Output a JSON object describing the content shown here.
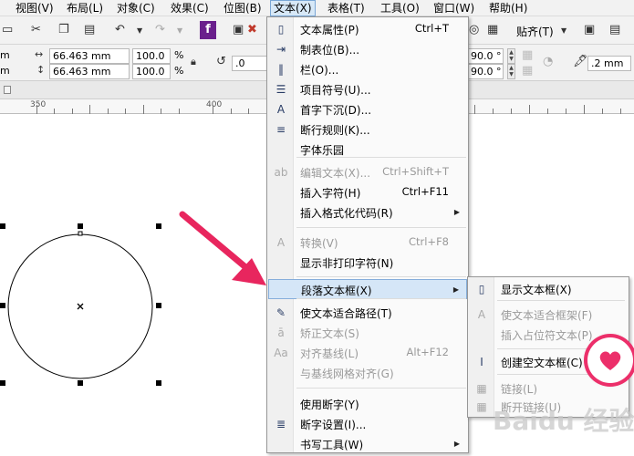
{
  "menubar": {
    "items": [
      {
        "label": "视图(V)"
      },
      {
        "label": "布局(L)"
      },
      {
        "label": "对象(C)"
      },
      {
        "label": "效果(C)"
      },
      {
        "label": "位图(B)"
      },
      {
        "label": "文本(X)"
      },
      {
        "label": "表格(T)"
      },
      {
        "label": "工具(O)"
      },
      {
        "label": "窗口(W)"
      },
      {
        "label": "帮助(H)"
      }
    ]
  },
  "toolbar": {
    "snap_label": "贴齐(T)",
    "width_value": "66.463 mm",
    "height_value": "66.463 mm",
    "scale_x": "100.0",
    "scale_y": "100.0",
    "percent": "%",
    "rotation_value": ".0",
    "angle_top": "90.0 °",
    "angle_bottom": "90.0 °",
    "outline_value": ".2 mm",
    "left_cut_top": "m",
    "left_cut_bottom": "m"
  },
  "ruler": {
    "labels": [
      "350",
      "400"
    ]
  },
  "text_menu": {
    "items": [
      {
        "icon": "text-properties-icon",
        "glyph": "▯",
        "label": "文本属性(P)",
        "shortcut": "Ctrl+T",
        "disabled": false
      },
      {
        "icon": "tabs-icon",
        "glyph": "⇥",
        "label": "制表位(B)...",
        "shortcut": "",
        "disabled": false
      },
      {
        "icon": "columns-icon",
        "glyph": "‖",
        "label": "栏(O)...",
        "shortcut": "",
        "disabled": false
      },
      {
        "icon": "bullets-icon",
        "glyph": "☰",
        "label": "项目符号(U)...",
        "shortcut": "",
        "disabled": false
      },
      {
        "icon": "drop-cap-icon",
        "glyph": "A",
        "label": "首字下沉(D)...",
        "shortcut": "",
        "disabled": false
      },
      {
        "icon": "line-break-rules-icon",
        "glyph": "≡",
        "label": "断行规则(K)...",
        "shortcut": "",
        "disabled": false
      },
      {
        "icon": "",
        "glyph": "",
        "label": "字体乐园",
        "shortcut": "",
        "disabled": false
      },
      {
        "icon": "edit-text-icon",
        "glyph": "ab",
        "label": "编辑文本(X)...",
        "shortcut": "Ctrl+Shift+T",
        "disabled": true
      },
      {
        "icon": "",
        "glyph": "",
        "label": "插入字符(H)",
        "shortcut": "Ctrl+F11",
        "disabled": false
      },
      {
        "icon": "",
        "glyph": "",
        "label": "插入格式化代码(R)",
        "shortcut": "",
        "disabled": false,
        "submenu": true
      },
      {
        "icon": "convert-icon",
        "glyph": "A",
        "label": "转换(V)",
        "shortcut": "Ctrl+F8",
        "disabled": true
      },
      {
        "icon": "",
        "glyph": "",
        "label": "显示非打印字符(N)",
        "shortcut": "",
        "disabled": false
      },
      {
        "icon": "",
        "glyph": "",
        "label": "段落文本框(X)",
        "shortcut": "",
        "disabled": false,
        "submenu": true,
        "highlighted": true
      },
      {
        "icon": "fit-text-to-path-icon",
        "glyph": "✎",
        "label": "使文本适合路径(T)",
        "shortcut": "",
        "disabled": false
      },
      {
        "icon": "straighten-text-icon",
        "glyph": "ā",
        "label": "矫正文本(S)",
        "shortcut": "",
        "disabled": true
      },
      {
        "icon": "align-baseline-icon",
        "glyph": "Aa",
        "label": "对齐基线(L)",
        "shortcut": "Alt+F12",
        "disabled": true
      },
      {
        "icon": "",
        "glyph": "",
        "label": "与基线网格对齐(G)",
        "shortcut": "",
        "disabled": true
      },
      {
        "icon": "",
        "glyph": "",
        "label": "使用断字(Y)",
        "shortcut": "",
        "disabled": false
      },
      {
        "icon": "hyphenation-settings-icon",
        "glyph": "≣",
        "label": "断字设置(I)...",
        "shortcut": "",
        "disabled": false
      },
      {
        "icon": "",
        "glyph": "",
        "label": "书写工具(W)",
        "shortcut": "",
        "disabled": false,
        "submenu": true
      }
    ]
  },
  "submenu": {
    "items": [
      {
        "icon": "show-text-frame-icon",
        "glyph": "▯",
        "label": "显示文本框(X)",
        "disabled": false
      },
      {
        "icon": "fit-text-to-frame-icon",
        "glyph": "A",
        "label": "使文本适合框架(F)",
        "disabled": true
      },
      {
        "icon": "",
        "glyph": "",
        "label": "插入占位符文本(P)",
        "disabled": true
      },
      {
        "icon": "create-empty-text-frame-icon",
        "glyph": "I",
        "label": "创建空文本框(C)",
        "disabled": false
      },
      {
        "icon": "link-icon",
        "glyph": "▦",
        "label": "链接(L)",
        "disabled": true
      },
      {
        "icon": "unlink-icon",
        "glyph": "▦",
        "label": "断开链接(U)",
        "disabled": true
      }
    ]
  },
  "colors": {
    "arrow": "#e8265e",
    "badge": "#ec2f6a",
    "highlight": "#d5e6f7"
  },
  "watermark": "Baidu 经验"
}
